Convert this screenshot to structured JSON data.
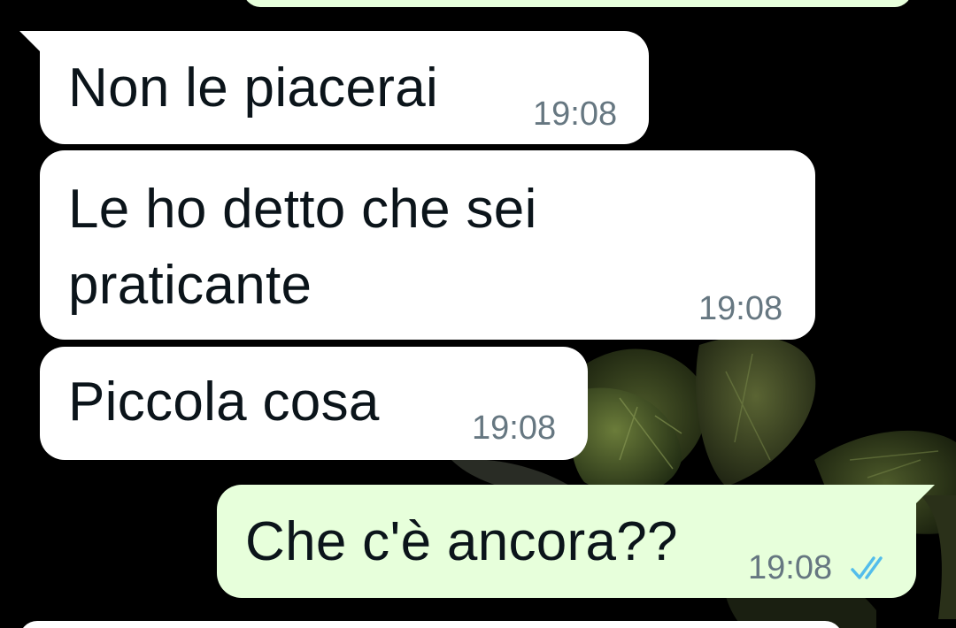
{
  "colors": {
    "background": "#000000",
    "incoming_bubble": "#ffffff",
    "outgoing_bubble": "#e7ffdb",
    "timestamp": "#667781",
    "read_ticks": "#53bdeb",
    "text": "#0b141a"
  },
  "messages": [
    {
      "direction": "incoming",
      "text": "Non le piacerai",
      "time": "19:08"
    },
    {
      "direction": "incoming",
      "text": "Le ho detto che sei\npraticante",
      "time": "19:08"
    },
    {
      "direction": "incoming",
      "text": "Piccola cosa",
      "time": "19:08"
    },
    {
      "direction": "outgoing",
      "text": "Che c'è ancora??",
      "time": "19:08",
      "status_icon": "double-check-read-icon"
    }
  ]
}
